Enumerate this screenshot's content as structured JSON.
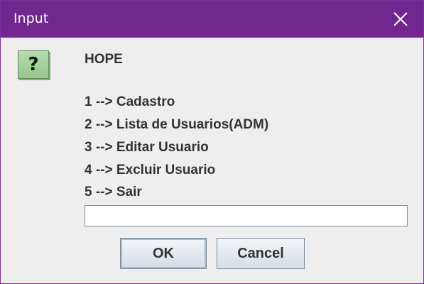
{
  "window": {
    "title": "Input",
    "accent": "#722690"
  },
  "icon": {
    "name": "question-icon",
    "glyph": "?"
  },
  "message": {
    "heading": "HOPE",
    "options": [
      "1 --> Cadastro",
      "2 --> Lista de Usuarios(ADM)",
      "3 --> Editar Usuario",
      "4 --> Excluir Usuario",
      "5 --> Sair"
    ]
  },
  "input": {
    "value": ""
  },
  "buttons": {
    "ok_label": "OK",
    "cancel_label": "Cancel"
  }
}
